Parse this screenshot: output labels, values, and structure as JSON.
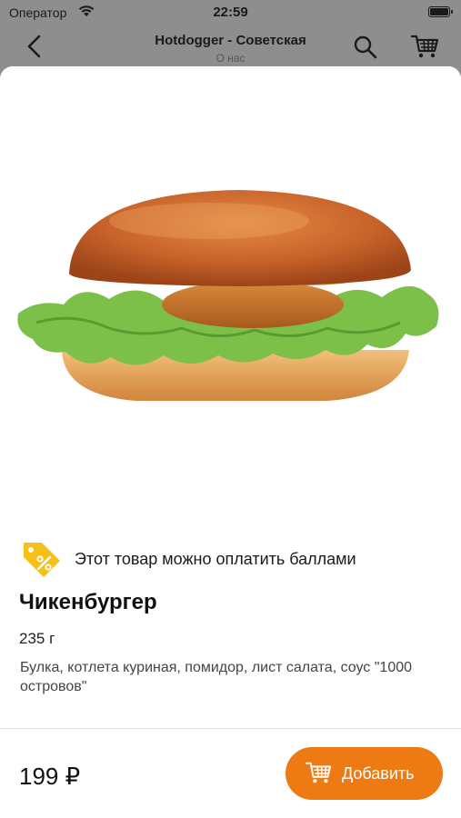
{
  "status_bar": {
    "carrier": "Оператор",
    "time": "22:59",
    "battery_level": 1.0
  },
  "nav": {
    "title": "Hotdogger - Советская",
    "subtitle": "О нас",
    "icons": [
      "back-chevron-icon",
      "search-icon",
      "cart-icon"
    ]
  },
  "product": {
    "image": "chicken-burger-photo",
    "points_notice": "Этот товар можно оплатить баллами",
    "name": "Чикенбургер",
    "weight": "235 г",
    "description": "Булка, котлета куриная, помидор, лист салата, соус \"1000 островов\"",
    "price": "199 ₽"
  },
  "actions": {
    "add_label": "Добавить"
  },
  "colors": {
    "accent": "#ee7a14",
    "badge": "#f5c018",
    "dim_overlay": "#8e8e8e"
  }
}
